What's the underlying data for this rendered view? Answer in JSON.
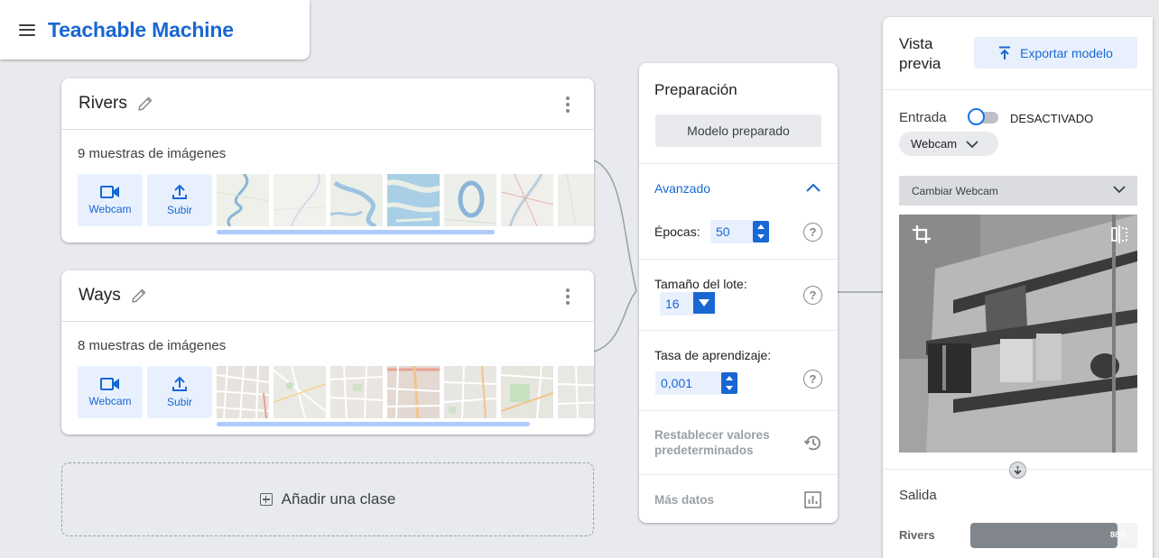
{
  "app": {
    "title": "Teachable Machine"
  },
  "classes": [
    {
      "name": "Rivers",
      "samples_text": "9 muestras de imágenes",
      "webcam_label": "Webcam",
      "upload_label": "Subir",
      "thumb_style": "rivers"
    },
    {
      "name": "Ways",
      "samples_text": "8 muestras de imágenes",
      "webcam_label": "Webcam",
      "upload_label": "Subir",
      "thumb_style": "ways"
    }
  ],
  "add_class_label": "Añadir una clase",
  "training": {
    "title": "Preparación",
    "train_button": "Modelo preparado",
    "advanced_label": "Avanzado",
    "epochs_label": "Épocas:",
    "epochs_value": "50",
    "batch_label": "Tamaño del lote:",
    "batch_value": "16",
    "lr_label": "Tasa de aprendizaje:",
    "lr_value": "0,001",
    "help_glyph": "?",
    "reset_label": "Restablecer valores predeterminados",
    "more_data_label": "Más datos"
  },
  "preview": {
    "title": "Vista previa",
    "export_button": "Exportar modelo",
    "input_label": "Entrada",
    "toggle_state": "DESACTIVADO",
    "source_chip": "Webcam",
    "camera_select": "Cambiar Webcam",
    "output_label": "Salida",
    "result": {
      "class": "Rivers",
      "percent_text": "88%",
      "fraction": 0.88
    }
  },
  "colors": {
    "accent": "#1967d2",
    "light_accent": "#e8f0fe",
    "background": "#e8eaed"
  }
}
